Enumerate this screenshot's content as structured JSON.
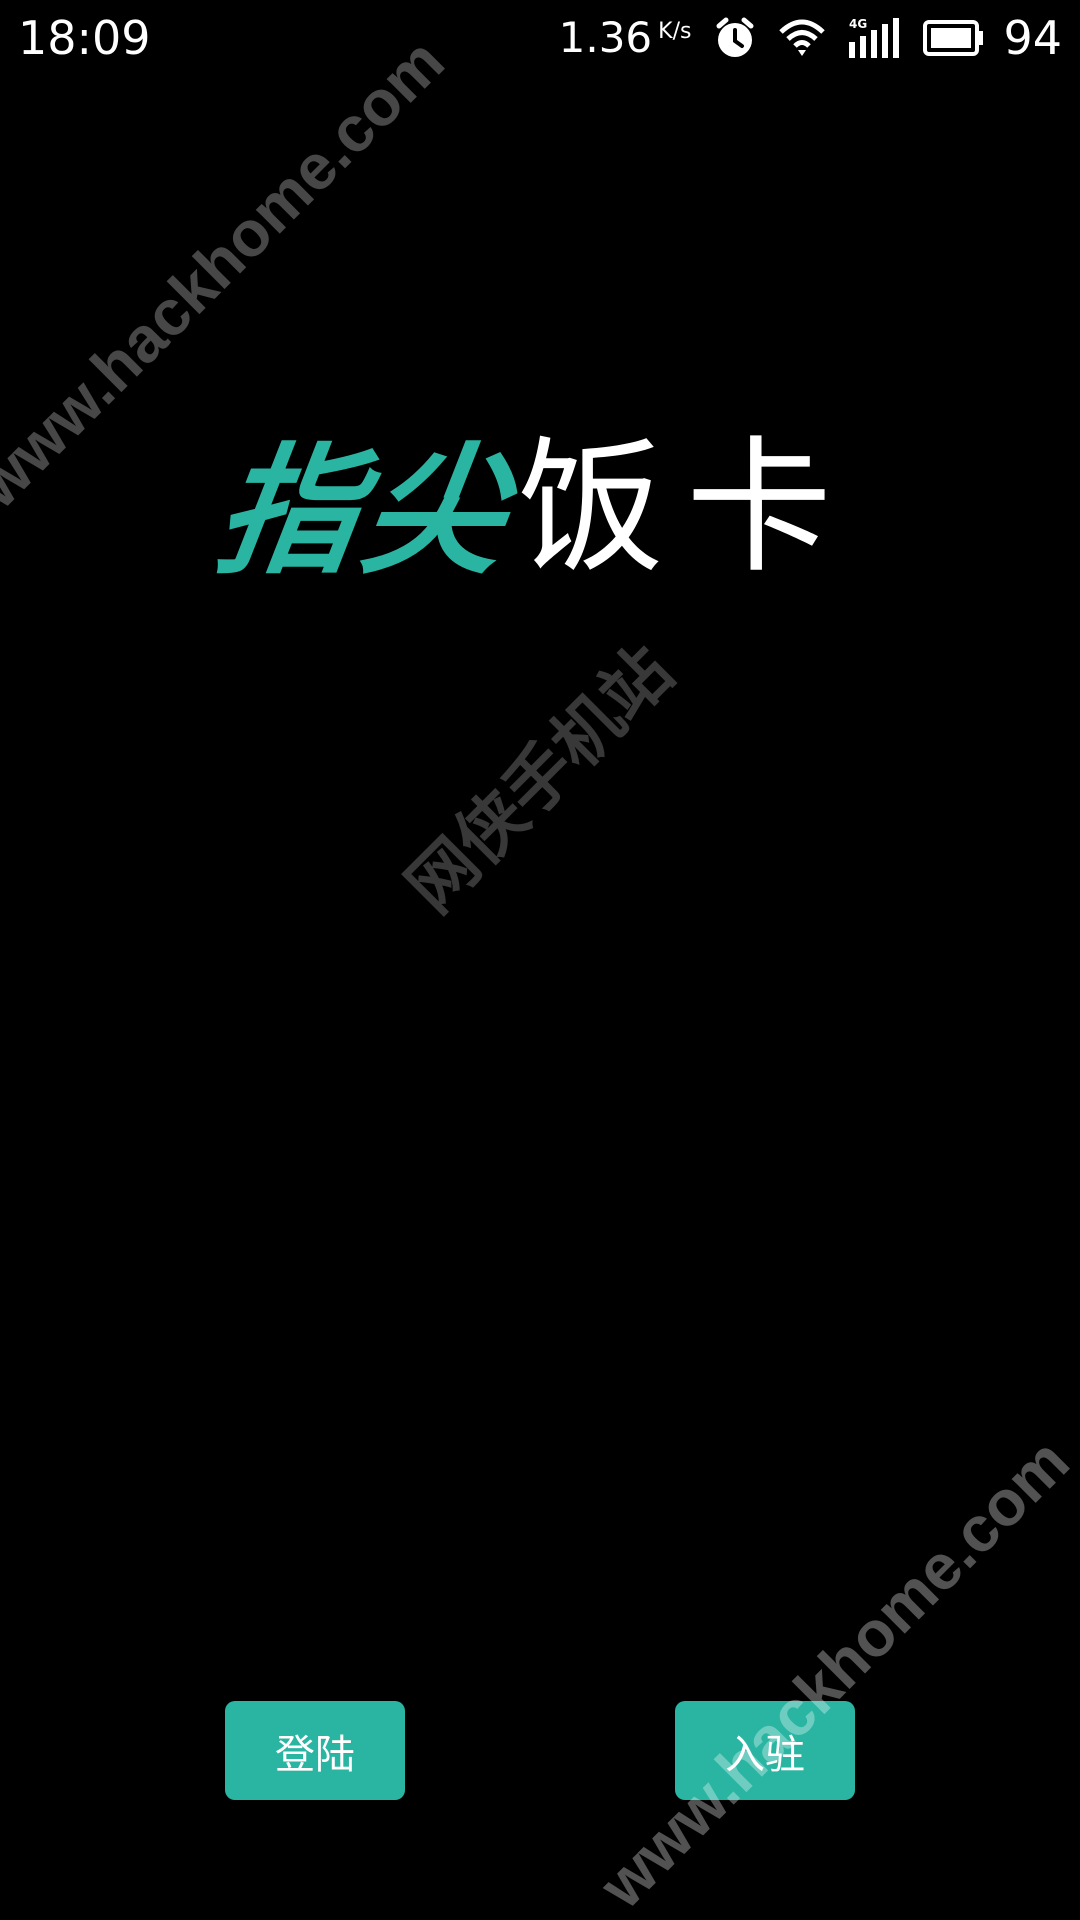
{
  "status_bar": {
    "time": "18:09",
    "net_speed": "1.36",
    "net_unit": "K/s",
    "battery": "94",
    "icons": [
      "alarm-icon",
      "wifi-icon",
      "signal-4g-icon",
      "battery-icon"
    ]
  },
  "logo": {
    "part1": "指尖",
    "part2": "饭卡",
    "accent_color": "#2ab5a3"
  },
  "buttons": {
    "login": "登陆",
    "join": "入驻"
  },
  "watermarks": {
    "top": "www.hackhome.com",
    "center": "网侠手机站",
    "bottom": "www.hackhome.com"
  },
  "colors": {
    "background": "#000000",
    "accent": "#2ab5a3",
    "text": "#ffffff"
  }
}
